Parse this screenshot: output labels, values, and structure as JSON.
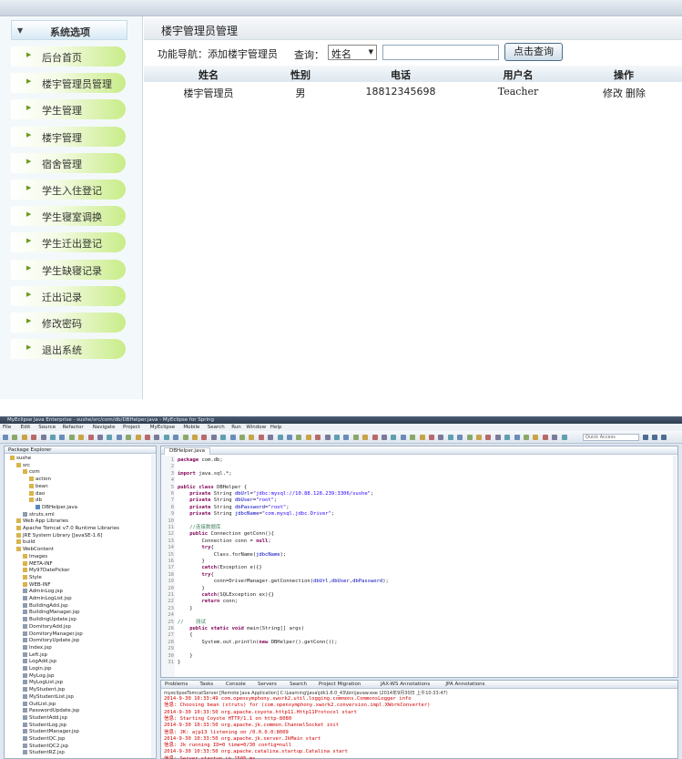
{
  "sidebar": {
    "title": "系统选项",
    "items": [
      {
        "label": "后台首页"
      },
      {
        "label": "楼宇管理员管理"
      },
      {
        "label": "学生管理"
      },
      {
        "label": "楼宇管理"
      },
      {
        "label": "宿舍管理"
      },
      {
        "label": "学生入住登记"
      },
      {
        "label": "学生寝室调换"
      },
      {
        "label": "学生迁出登记"
      },
      {
        "label": "学生缺寝记录"
      },
      {
        "label": "迁出记录"
      },
      {
        "label": "修改密码"
      },
      {
        "label": "退出系统"
      }
    ]
  },
  "main": {
    "title": "楼宇管理员管理",
    "nav_label": "功能导航：",
    "nav_link": "添加楼宇管理员",
    "query_label": "查询：",
    "query_select": "姓名",
    "query_input": "",
    "query_button": "点击查询",
    "columns": [
      "姓名",
      "性别",
      "电话",
      "用户名",
      "操作"
    ],
    "rows": [
      {
        "name": "楼宇管理员",
        "gender": "男",
        "phone": "18812345698",
        "username": "Teacher",
        "edit": "修改",
        "delete": "删除"
      }
    ]
  },
  "ide": {
    "title": "MyEclipse Java Enterprise - sushe/src/com/db/DBHelper.java - MyEclipse for Spring",
    "menu": [
      "File",
      "Edit",
      "Source",
      "Refactor",
      "Navigate",
      "Project",
      "MyEclipse",
      "Mobile",
      "Search",
      "Run",
      "Window",
      "Help"
    ],
    "quick_access": "Quick Access",
    "package_explorer_tab": "Package Explorer",
    "tree": [
      {
        "label": "sushe",
        "depth": 0
      },
      {
        "label": "src",
        "depth": 1
      },
      {
        "label": "com",
        "depth": 2
      },
      {
        "label": "action",
        "depth": 3
      },
      {
        "label": "bean",
        "depth": 3
      },
      {
        "label": "dao",
        "depth": 3
      },
      {
        "label": "db",
        "depth": 3
      },
      {
        "label": "DBHelper.java",
        "depth": 4
      },
      {
        "label": "struts.xml",
        "depth": 2
      },
      {
        "label": "Web App Libraries",
        "depth": 1
      },
      {
        "label": "Apache Tomcat v7.0 Runtime Libraries",
        "depth": 1
      },
      {
        "label": "JRE System Library [JavaSE-1.6]",
        "depth": 1
      },
      {
        "label": "build",
        "depth": 1
      },
      {
        "label": "WebContent",
        "depth": 1
      },
      {
        "label": "Images",
        "depth": 2
      },
      {
        "label": "META-INF",
        "depth": 2
      },
      {
        "label": "My97DatePicker",
        "depth": 2
      },
      {
        "label": "Style",
        "depth": 2
      },
      {
        "label": "WEB-INF",
        "depth": 2
      },
      {
        "label": "AdminLog.jsp",
        "depth": 2
      },
      {
        "label": "AdminLogList.jsp",
        "depth": 2
      },
      {
        "label": "BuildingAdd.jsp",
        "depth": 2
      },
      {
        "label": "BuildingManager.jsp",
        "depth": 2
      },
      {
        "label": "BuildingUpdate.jsp",
        "depth": 2
      },
      {
        "label": "DomitoryAdd.jsp",
        "depth": 2
      },
      {
        "label": "DomitoryManager.jsp",
        "depth": 2
      },
      {
        "label": "DomitoryUpdate.jsp",
        "depth": 2
      },
      {
        "label": "Index.jsp",
        "depth": 2
      },
      {
        "label": "Left.jsp",
        "depth": 2
      },
      {
        "label": "LogAdd.jsp",
        "depth": 2
      },
      {
        "label": "Login.jsp",
        "depth": 2
      },
      {
        "label": "MyLog.jsp",
        "depth": 2
      },
      {
        "label": "MyLogList.jsp",
        "depth": 2
      },
      {
        "label": "MyStudent.jsp",
        "depth": 2
      },
      {
        "label": "MyStudentList.jsp",
        "depth": 2
      },
      {
        "label": "OutList.jsp",
        "depth": 2
      },
      {
        "label": "PasswordUpdate.jsp",
        "depth": 2
      },
      {
        "label": "StudentAdd.jsp",
        "depth": 2
      },
      {
        "label": "StudentLog.jsp",
        "depth": 2
      },
      {
        "label": "StudentManager.jsp",
        "depth": 2
      },
      {
        "label": "StudentQC.jsp",
        "depth": 2
      },
      {
        "label": "StudentQC2.jsp",
        "depth": 2
      },
      {
        "label": "StudentRZ.jsp",
        "depth": 2
      }
    ],
    "editor_tab": "DBHelper.java",
    "code": [
      {
        "n": "1",
        "t": "package com.db;"
      },
      {
        "n": "2",
        "t": ""
      },
      {
        "n": "3",
        "t": "import java.sql.*;"
      },
      {
        "n": "4",
        "t": ""
      },
      {
        "n": "5",
        "t": "public class DBHelper {"
      },
      {
        "n": "6",
        "t": "    private String dbUrl=\"jdbc:mysql://10.88.128.239:3306/sushe\";"
      },
      {
        "n": "7",
        "t": "    private String dbUser=\"root\";"
      },
      {
        "n": "8",
        "t": "    private String dbPassword=\"root\";"
      },
      {
        "n": "9",
        "t": "    private String jdbcName=\"com.mysql.jdbc.Driver\";"
      },
      {
        "n": "10",
        "t": ""
      },
      {
        "n": "11",
        "t": "    //连接数据库"
      },
      {
        "n": "12",
        "t": "    public Connection getConn(){"
      },
      {
        "n": "13",
        "t": "        Connection conn = null;"
      },
      {
        "n": "14",
        "t": "        try{"
      },
      {
        "n": "15",
        "t": "            Class.forName(jdbcName);"
      },
      {
        "n": "16",
        "t": "        }"
      },
      {
        "n": "17",
        "t": "        catch(Exception e){}"
      },
      {
        "n": "18",
        "t": "        try{"
      },
      {
        "n": "19",
        "t": "            conn=DriverManager.getConnection(dbUrl,dbUser,dbPassword);"
      },
      {
        "n": "20",
        "t": "        }"
      },
      {
        "n": "21",
        "t": "        catch(SQLException ex){}"
      },
      {
        "n": "22",
        "t": "        return conn;"
      },
      {
        "n": "23",
        "t": "    }"
      },
      {
        "n": "24",
        "t": ""
      },
      {
        "n": "25",
        "t": "//    测试"
      },
      {
        "n": "26",
        "t": "    public static void main(String[] args)"
      },
      {
        "n": "27",
        "t": "    {"
      },
      {
        "n": "28",
        "t": "        System.out.println(new DBHelper().getConn());"
      },
      {
        "n": "29",
        "t": ""
      },
      {
        "n": "30",
        "t": "    }"
      },
      {
        "n": "31",
        "t": "}"
      }
    ],
    "console_tabs": [
      "Problems",
      "Tasks",
      "Console",
      "Servers",
      "Search",
      "Project Migration",
      "JAX-WS Annotations",
      "JPA Annotations"
    ],
    "console_header": "myeclipseTomcatServer [Remote Java Application] C:\\Learning\\Java\\jdk1.6.0_43\\bin\\javaw.exe (2014年9月30日 上午10:33:47)",
    "console": [
      "2014-9-30 10:33:49 com.opensymphony.xwork2.util.logging.commons.CommonsLogger info",
      "信息: Choosing bean (struts) for (com.opensymphony.xwork2.conversion.impl.XWorkConverter)",
      "2014-9-30 10:33:50 org.apache.coyote.http11.Http11Protocol start",
      "信息: Starting Coyote HTTP/1.1 on http-8080",
      "2014-9-30 10:33:50 org.apache.jk.common.ChannelSocket init",
      "信息: JK: ajp13 listening on /0.0.0.0:8009",
      "2014-9-30 10:33:50 org.apache.jk.server.JkMain start",
      "信息: Jk running ID=0 time=0/30  config=null",
      "2014-9-30 10:33:50 org.apache.catalina.startup.Catalina start",
      "信息: Server startup in 1505 ms"
    ]
  }
}
